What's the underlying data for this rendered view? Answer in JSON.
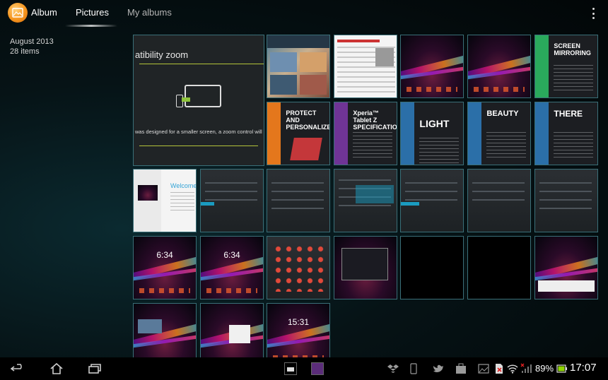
{
  "action_bar": {
    "app_title": "Album",
    "tabs": [
      {
        "label": "Pictures",
        "active": true
      },
      {
        "label": "My albums",
        "active": false
      }
    ],
    "app_icon": "album-icon",
    "overflow_icon": "overflow-menu-icon"
  },
  "album": {
    "date": "August 2013",
    "count": "28 items"
  },
  "thumbnails": {
    "zoom_screenshot": {
      "title": "atibility zoom",
      "caption": "was designed for a smaller screen, a zoom control will appear by"
    },
    "promo_1": {
      "headline": "PROTECT AND PERSONALIZE"
    },
    "promo_2": {
      "headline": "Xperia™ Tablet Z SPECIFICATIONS"
    },
    "promo_3": {
      "headline": "LIGHT"
    },
    "promo_4": {
      "headline": "BEAUTY"
    },
    "promo_5": {
      "headline": "THERE"
    },
    "promo_6": {
      "headline": "SCREEN MIRRORING"
    },
    "welcome": {
      "title": "Welcome"
    },
    "lock_1": {
      "time": "6:34"
    },
    "lock_2": {
      "time": "6:34"
    },
    "lock_3": {
      "time": "15:31"
    }
  },
  "system_bar": {
    "back_icon": "back-icon",
    "home_icon": "home-icon",
    "recents_icon": "recent-apps-icon",
    "battery_percent": "89%",
    "time": "17:07",
    "colors": {
      "battery": "#8fd400",
      "accent": "#1a9bc0",
      "thumb_border": "#3a6f78"
    }
  }
}
